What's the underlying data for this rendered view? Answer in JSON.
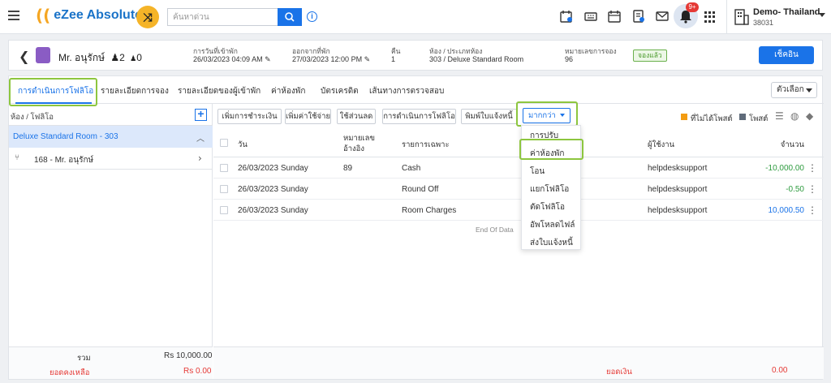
{
  "app": {
    "logo_text": "eZee Absolute"
  },
  "search": {
    "placeholder": "ค้นหาด่วน"
  },
  "notifications": {
    "badge": "9+"
  },
  "hotel": {
    "name": "Demo- Thailand",
    "code": "38031"
  },
  "guest": {
    "name": "Mr. อนุรักษ์",
    "adults": "2",
    "children": "0",
    "arrival_label": "การวันที่เข้าพัก",
    "arrival_value": "26/03/2023 04:09 AM",
    "departure_label": "ออกจากที่พัก",
    "departure_value": "27/03/2023 12:00 PM",
    "nights_label": "คืน",
    "nights_value": "1",
    "room_label": "ห้อง / ประเภทห้อง",
    "room_value": "303 / Deluxe Standard Room",
    "booking_label": "หมายเลขการจอง",
    "booking_value": "96",
    "status_badge": "จองแล้ว",
    "checkin_label": "เช็คอิน"
  },
  "tabs": [
    {
      "label": "การดำเนินการโฟลิโอ",
      "active": true
    },
    {
      "label": "รายละเอียดการจอง"
    },
    {
      "label": "รายละเอียดของผู้เข้าพัก"
    },
    {
      "label": "ค่าห้องพัก"
    },
    {
      "label": "บัตรเครดิต"
    },
    {
      "label": "เส้นทางการตรวจสอบ"
    }
  ],
  "options_label": "ตัวเลือก",
  "left": {
    "header": "ห้อง / โฟลิโอ",
    "room_item": "Deluxe Standard Room - 303",
    "folio_item": "168 - Mr. อนุรักษ์",
    "total_label": "รวม",
    "total_value": "Rs 10,000.00",
    "balance_label": "ยอดคงเหลือ",
    "balance_value": "Rs 0.00"
  },
  "actions": {
    "add_payment": "เพิ่มการชำระเงิน",
    "add_charge": "เพิ่มค่าใช้จ่าย",
    "discount": "ใช้ส่วนลด",
    "folio_ops": "การดำเนินการโฟลิโอ",
    "print_invoice": "พิมพ์ใบแจ้งหนี้",
    "more": "มากกว่า"
  },
  "legend": {
    "unposted": "ที่ไม่ได้โพสต์",
    "posted": "โพสต์"
  },
  "colors": {
    "accent": "#1a73e8",
    "highlight": "#8dc63f",
    "unposted": "#f39c12",
    "posted": "#5f6b7a",
    "negative": "#2e9b3f"
  },
  "table": {
    "headers": {
      "date": "วัน",
      "ref_line1": "หมายเลข",
      "ref_line2": "อ้างอิง",
      "particulars": "รายการเฉพาะ",
      "user": "ผู้ใช้งาน",
      "amount": "จำนวน"
    },
    "rows": [
      {
        "date": "26/03/2023 Sunday",
        "ref": "89",
        "desc": "Cash",
        "user": "helpdesksupport",
        "amount": "-10,000.00"
      },
      {
        "date": "26/03/2023 Sunday",
        "ref": "",
        "desc": "Round Off",
        "user": "helpdesksupport",
        "amount": "-0.50"
      },
      {
        "date": "26/03/2023 Sunday",
        "ref": "",
        "desc": "Room Charges",
        "user": "helpdesksupport",
        "amount": "10,000.50"
      }
    ],
    "end_text": "End Of Data",
    "paid_label": "ยอดเงิน",
    "paid_value": "0.00"
  },
  "dropdown": {
    "items": [
      "การปรับ",
      "ค่าห้องพัก",
      "โอน",
      "แยกโฟลิโอ",
      "ตัดโฟลิโอ",
      "อัพโหลดไฟล์",
      "ส่งใบแจ้งหนี้"
    ]
  }
}
